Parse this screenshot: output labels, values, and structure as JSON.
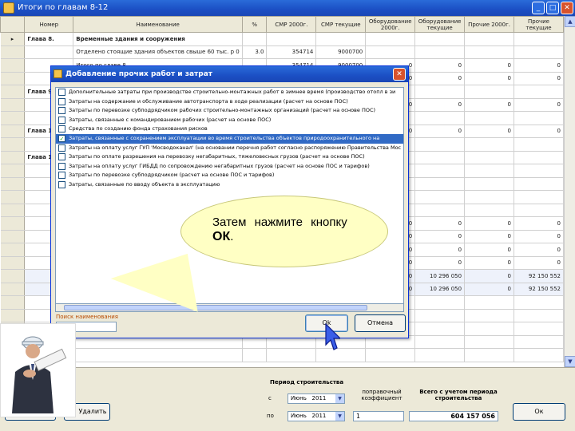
{
  "window": {
    "title": "Итоги по главам 8-12",
    "min_icon": "minimize-icon",
    "max_icon": "maximize-icon",
    "close_icon": "close-icon"
  },
  "grid": {
    "headers": [
      "",
      "Номер",
      "Наименование",
      "%",
      "СМР 2000г.",
      "СМР текущие",
      "Оборудование 2000г.",
      "Оборудование текущие",
      "Прочие 2000г.",
      "Прочие текущие"
    ],
    "rows": [
      [
        "▸",
        "Глава 8.",
        "Временные здания и сооружения",
        "",
        "",
        "",
        "",
        "",
        "",
        ""
      ],
      [
        "",
        "",
        "Отделено стоящие здания объектов свыше 60 тыс. р 0",
        "3.0",
        "354714",
        "9000700",
        "",
        "",
        "",
        ""
      ],
      [
        "",
        "",
        "Итого по главе 8",
        "",
        "354714",
        "9000700",
        "0",
        "0",
        "0",
        "0"
      ],
      [
        "",
        "",
        "",
        "",
        "",
        "",
        "0",
        "0",
        "0",
        "0"
      ],
      [
        "",
        "Глава 9.",
        "",
        "",
        "",
        "",
        "",
        "",
        "",
        ""
      ],
      [
        "",
        "",
        "",
        "",
        "",
        "",
        "0",
        "0",
        "0",
        "0"
      ],
      [
        "",
        "",
        "",
        "",
        "",
        "",
        "",
        "",
        "",
        ""
      ],
      [
        "",
        "Глава 1",
        "",
        "",
        "",
        "",
        "0",
        "0",
        "0",
        "0"
      ],
      [
        "",
        "",
        "",
        "",
        "",
        "",
        "",
        "",
        "",
        ""
      ],
      [
        "",
        "Глава 1",
        "",
        "",
        "",
        "",
        "",
        "",
        "",
        ""
      ],
      [
        "",
        "",
        "",
        "",
        "",
        "",
        "",
        "",
        "",
        ""
      ],
      [
        "",
        "",
        "",
        "",
        "",
        "",
        "",
        "",
        "",
        ""
      ],
      [
        "",
        "",
        "",
        "",
        "",
        "",
        "",
        "",
        "",
        ""
      ],
      [
        "",
        "",
        "",
        "",
        "",
        "",
        "",
        "",
        "",
        ""
      ],
      [
        "",
        "",
        "",
        "",
        "",
        "",
        "0",
        "0",
        "0",
        "0"
      ],
      [
        "",
        "",
        "",
        "",
        "",
        "",
        "0",
        "0",
        "0",
        "0"
      ],
      [
        "",
        "",
        "",
        "",
        "",
        "",
        "0",
        "0",
        "0",
        "0"
      ],
      [
        "",
        "",
        "",
        "",
        "",
        "",
        "0",
        "0",
        "0",
        "0"
      ],
      [
        "",
        "",
        "",
        "",
        "",
        "",
        "0",
        "10 296 050",
        "0",
        "92 150 552"
      ],
      [
        "",
        "",
        "",
        "",
        "",
        "",
        "0",
        "10 296 050",
        "0",
        "92 150 552"
      ],
      [
        "",
        "",
        "",
        "",
        "",
        "",
        "",
        "",
        "",
        ""
      ],
      [
        "",
        "",
        "",
        "",
        "",
        "",
        "",
        "",
        "",
        ""
      ],
      [
        "",
        "",
        "",
        "",
        "",
        "",
        "",
        "",
        "",
        ""
      ],
      [
        "",
        "",
        "",
        "",
        "",
        "",
        "",
        "",
        "",
        ""
      ],
      [
        "",
        "",
        "",
        "",
        "",
        "",
        "",
        "",
        "",
        ""
      ]
    ]
  },
  "bottom": {
    "period_label": "Период строительства",
    "from_label": "с",
    "to_label": "по",
    "from_month": "Июнь",
    "from_year": "2011",
    "to_month": "Июнь",
    "to_year": "2011",
    "coef_label": "поправочный коэффициент",
    "coef_value": "1",
    "total_label": "Всего с учетом периода строительства",
    "total_value": "604 157 056",
    "ok_label": "Ок",
    "delete_label": "Удалить"
  },
  "dialog": {
    "title": "Добавление прочих работ и затрат",
    "items": [
      {
        "label": "Дополнительные затраты при производстве строительно-монтажных работ в зимнее время (производство отопл в зи",
        "checked": false,
        "highlight": false
      },
      {
        "label": "Затраты на содержание и обслуживание автотранспорта в ходе реализации (расчет на основе ПОС)",
        "checked": false,
        "highlight": false
      },
      {
        "label": "Затраты по перевозке субподрядчиком рабочих строительно-монтажных организаций (расчет на основе ПОС)",
        "checked": false,
        "highlight": false
      },
      {
        "label": "Затраты, связанные с командированием рабочих (расчет на основе ПОС)",
        "checked": false,
        "highlight": false
      },
      {
        "label": "Средства по созданию фонда страхования рисков",
        "checked": false,
        "highlight": false
      },
      {
        "label": "Затраты, связанные с сохранением эксплуатации во время строительства объектов природоохранительного на",
        "checked": true,
        "highlight": true
      },
      {
        "label": "Затраты на оплату услуг ГУП 'Мосводоканал' (на основании перечня работ согласно распоряжению Правительства Мос",
        "checked": false,
        "highlight": false
      },
      {
        "label": "Затраты по оплате разрешения на перевозку негабаритных, тяжеловесных грузов (расчет на основе ПОС)",
        "checked": false,
        "highlight": false
      },
      {
        "label": "Затраты на оплату услуг ГИБДД по сопровождению негабаритных грузов (расчет на основе ПОС и тарифов)",
        "checked": false,
        "highlight": false
      },
      {
        "label": "Затраты по перевозке субподрядчиком (расчет на основе ПОС и тарифов)",
        "checked": false,
        "highlight": false
      },
      {
        "label": "Затраты, связанные по вводу объекта в эксплуатацию",
        "checked": false,
        "highlight": false
      }
    ],
    "search_label": "Поиск наименования",
    "ok_label": "Ok",
    "cancel_label": "Отмена"
  },
  "callout": {
    "text": "Затем нажмите кнопку",
    "button_name": "ОК",
    "period": "."
  },
  "colors": {
    "titlebar": "#1b4fc4",
    "highlight": "#316ac5",
    "callout_bg": "#ffffc4"
  }
}
